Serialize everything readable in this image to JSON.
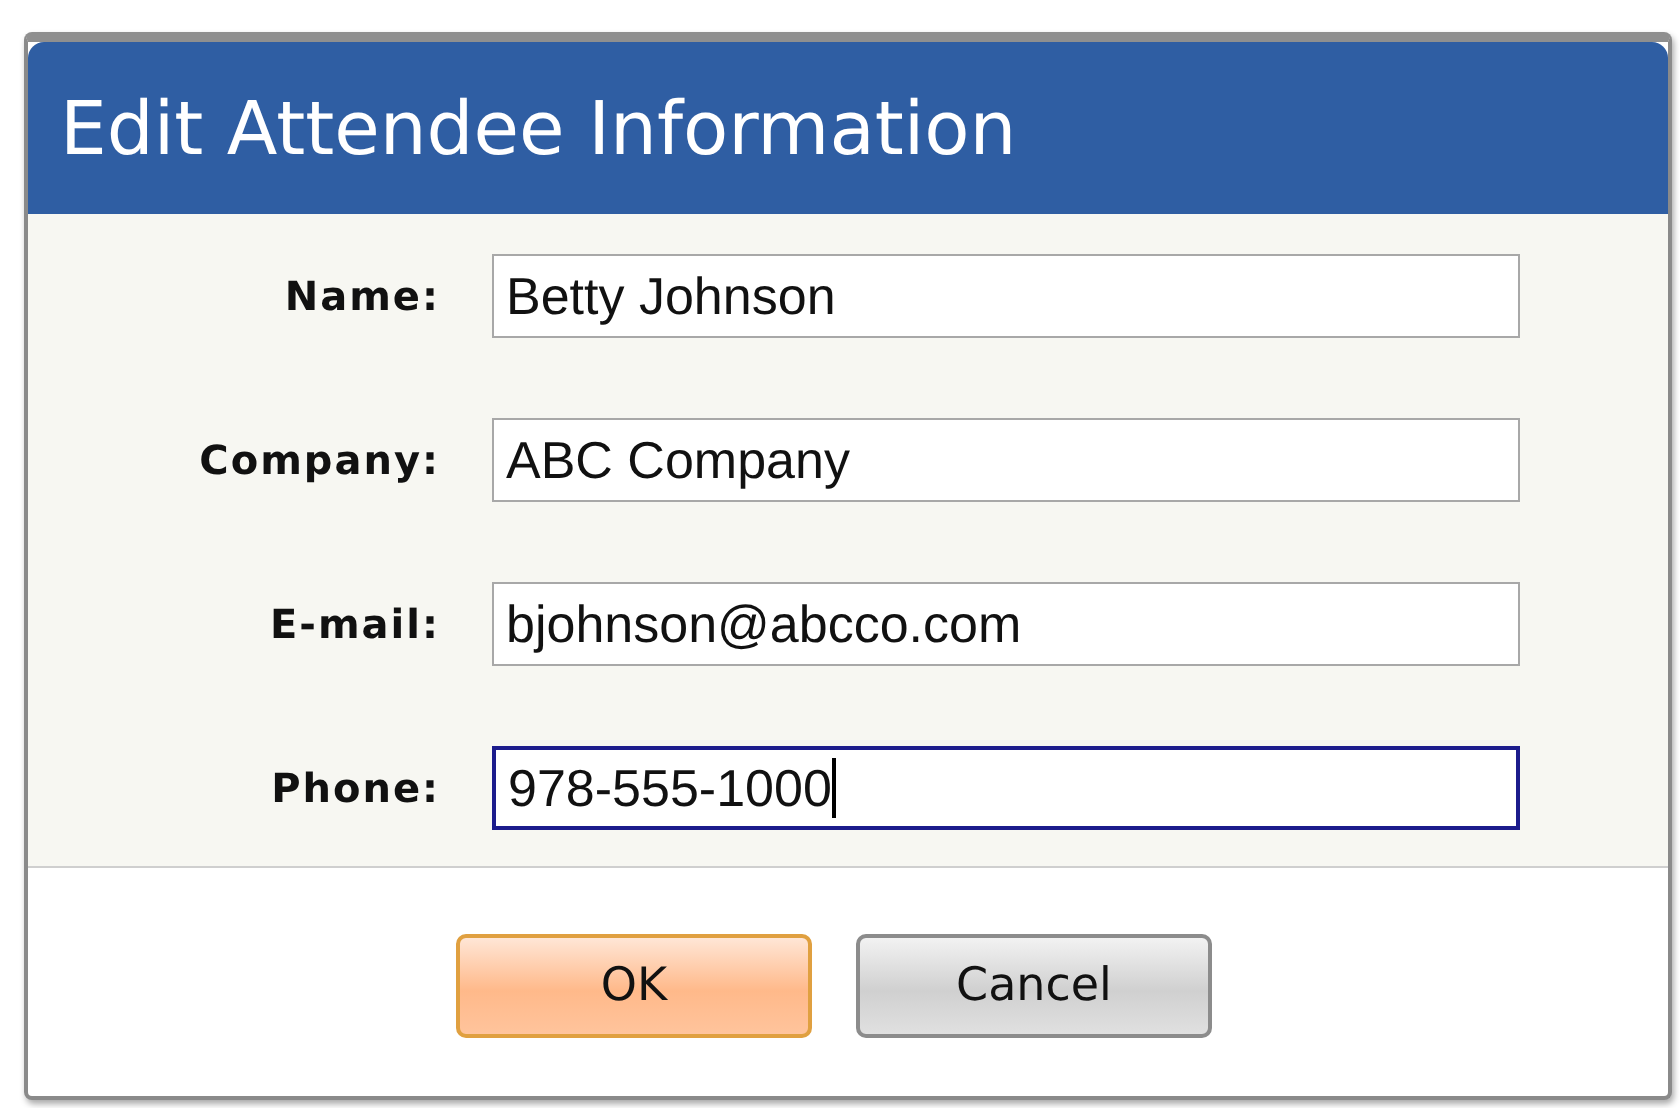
{
  "dialog": {
    "title": "Edit Attendee Information"
  },
  "fields": [
    {
      "label": "Name:",
      "value": "Betty Johnson",
      "focused": false
    },
    {
      "label": "Company:",
      "value": "ABC Company",
      "focused": false
    },
    {
      "label": "E-mail:",
      "value": "bjohnson@abcco.com",
      "focused": false
    },
    {
      "label": "Phone:",
      "value": "978-555-1000",
      "focused": true
    }
  ],
  "buttons": [
    {
      "label": "OK",
      "kind": "primary"
    },
    {
      "label": "Cancel",
      "kind": "secondary"
    }
  ]
}
